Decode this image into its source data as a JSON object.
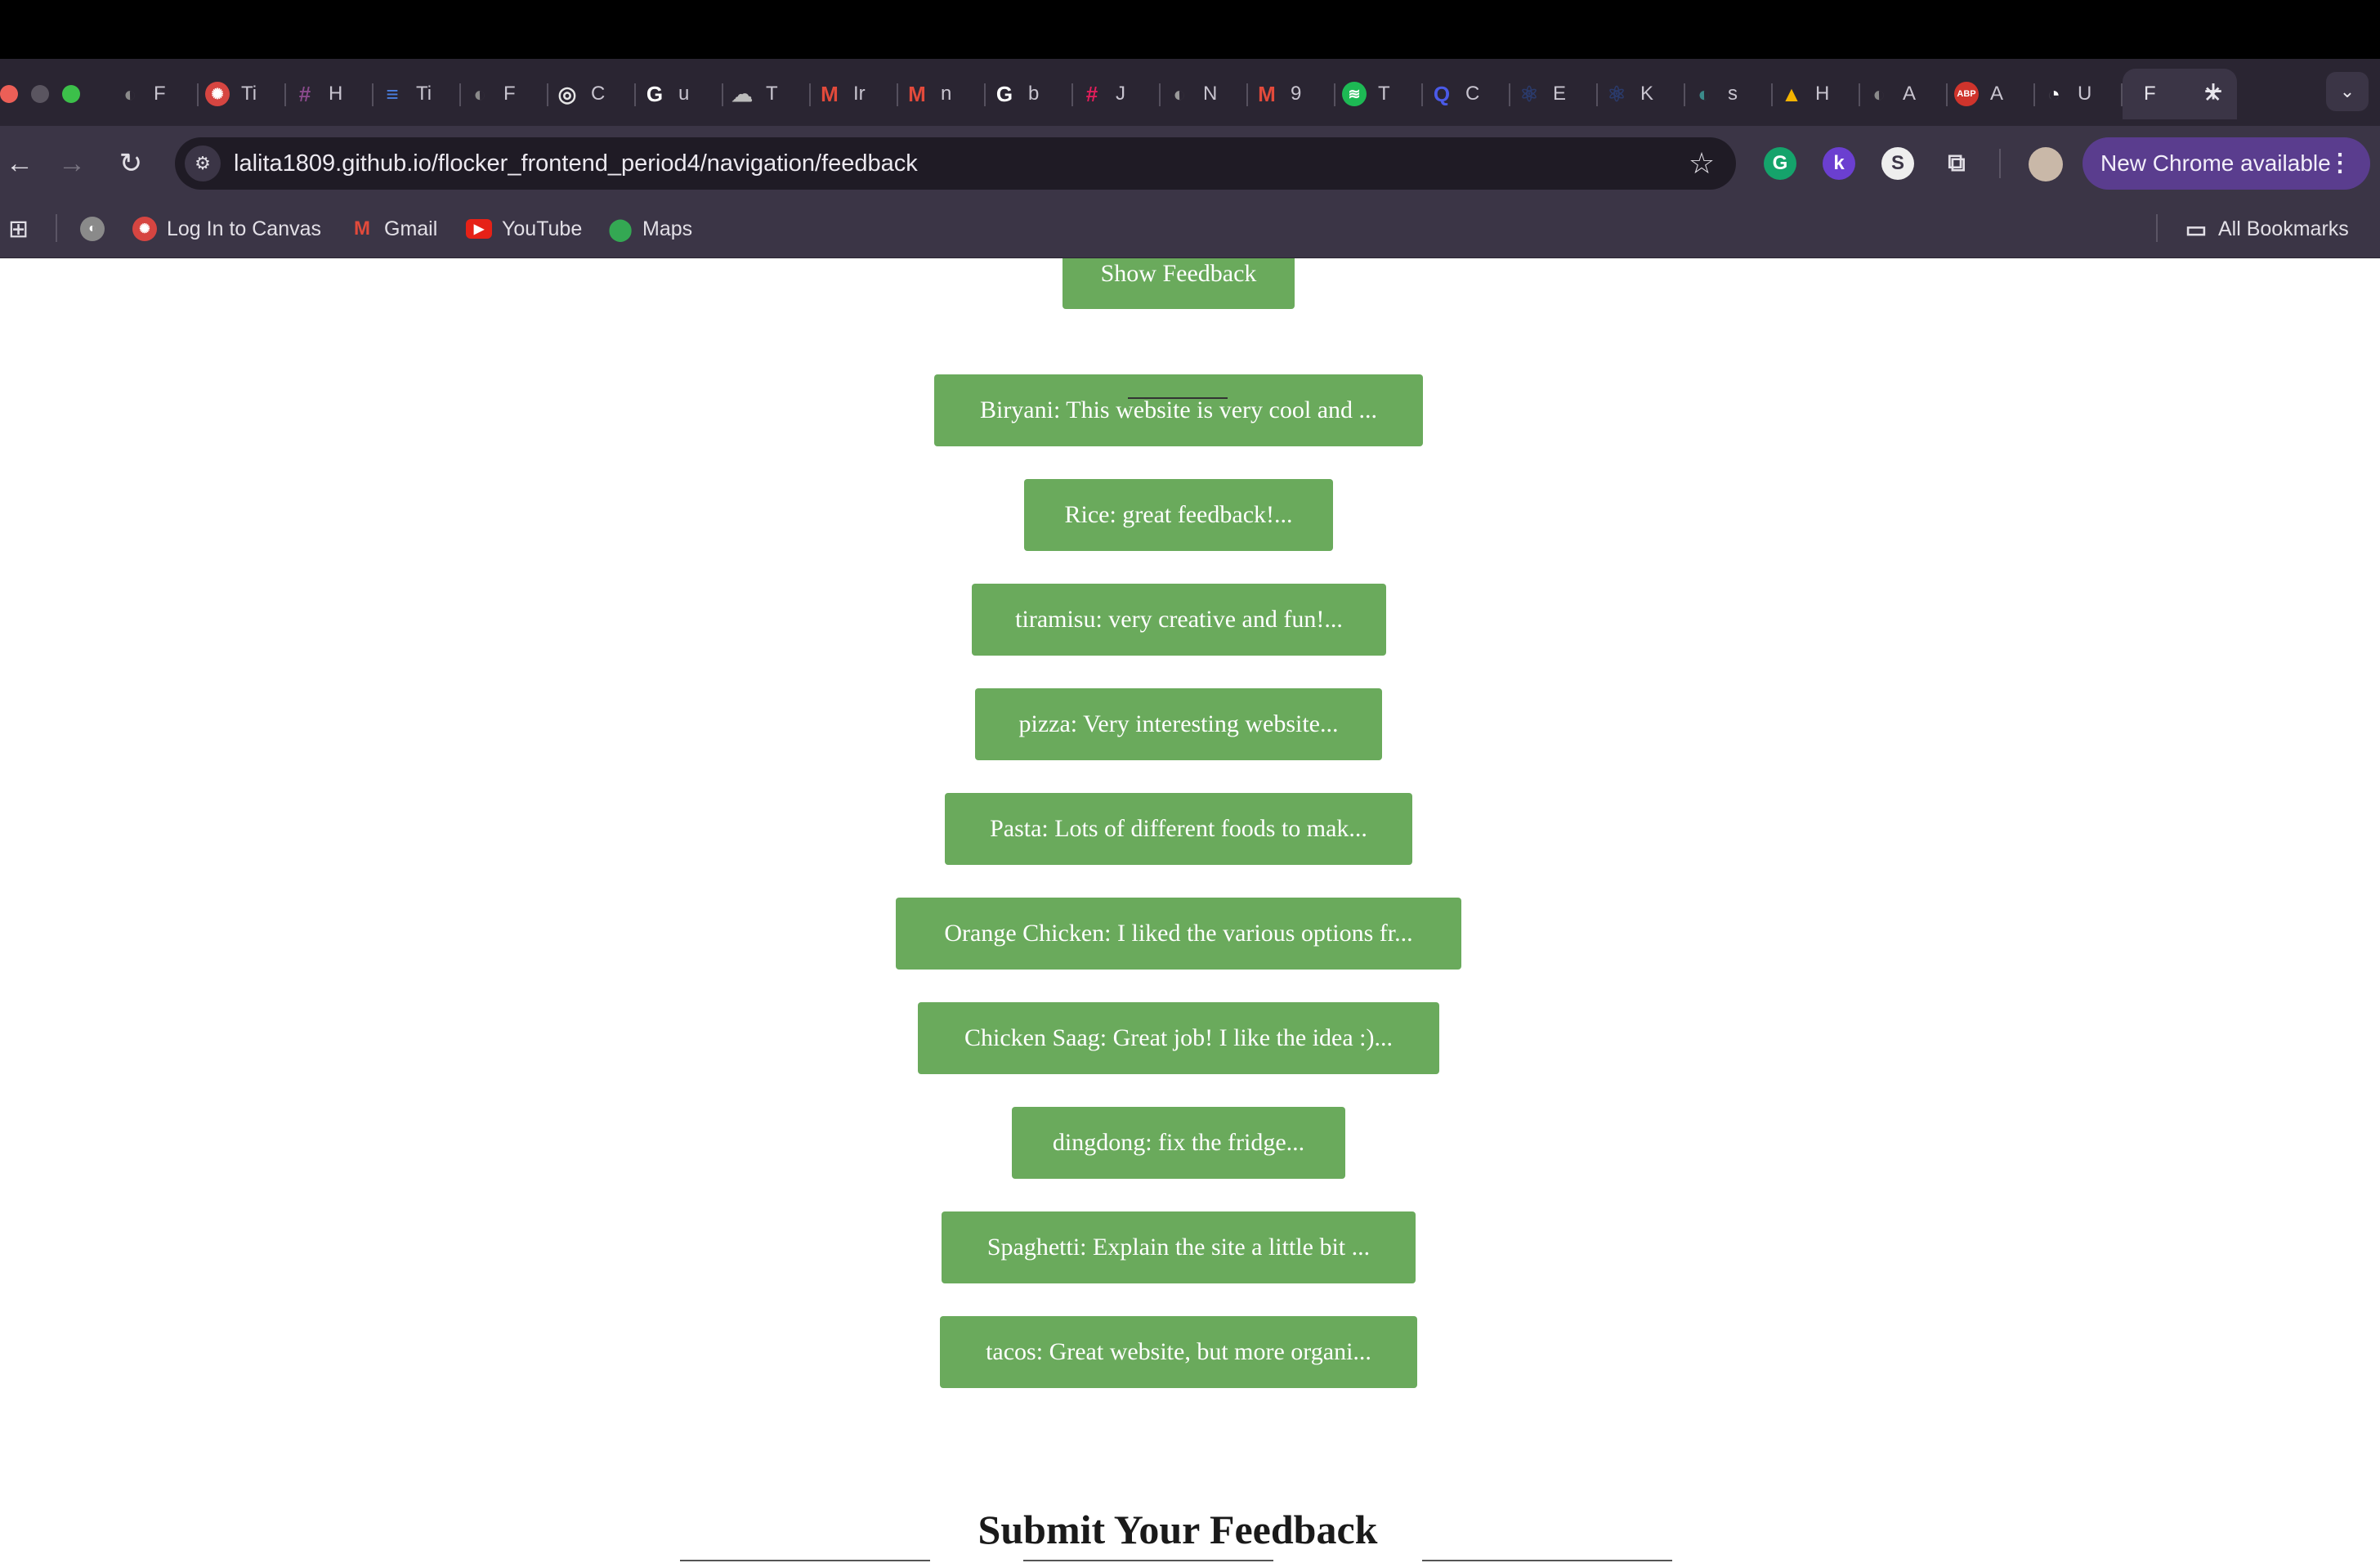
{
  "browser": {
    "tabs": [
      {
        "icon": "globe-icon",
        "label": "F",
        "color": "#8a8a8a"
      },
      {
        "icon": "canvas-icon",
        "label": "Ti",
        "color": "#d64541"
      },
      {
        "icon": "slack-icon",
        "label": "H",
        "color": "#8a4a8c"
      },
      {
        "icon": "docs-icon",
        "label": "Ti",
        "color": "#4a7fe0"
      },
      {
        "icon": "globe-icon",
        "label": "F",
        "color": "#8a8a8a"
      },
      {
        "icon": "openai-icon",
        "label": "C",
        "color": "#e6e6e6"
      },
      {
        "icon": "google-icon",
        "label": "u",
        "color": "#ffffff"
      },
      {
        "icon": "cloud-icon",
        "label": "T",
        "color": "#bbbbbb"
      },
      {
        "icon": "gmail-icon",
        "label": "Ir",
        "color": "#e24a3b"
      },
      {
        "icon": "gmail-icon",
        "label": "n",
        "color": "#e24a3b"
      },
      {
        "icon": "google-icon",
        "label": "b",
        "color": "#ffffff"
      },
      {
        "icon": "slack-icon",
        "label": "J",
        "color": "#e01e5a"
      },
      {
        "icon": "globe-icon",
        "label": "N",
        "color": "#9a9a9a"
      },
      {
        "icon": "gmail-icon",
        "label": "9",
        "color": "#e24a3b"
      },
      {
        "icon": "spotify-icon",
        "label": "T",
        "color": "#1db954"
      },
      {
        "icon": "search-circle-icon",
        "label": "C",
        "color": "#4a5ae8"
      },
      {
        "icon": "react-icon",
        "label": "E",
        "color": "#2a3a6a"
      },
      {
        "icon": "react-icon",
        "label": "K",
        "color": "#2a3a6a"
      },
      {
        "icon": "globe-icon",
        "label": "s",
        "color": "#3b8a8a"
      },
      {
        "icon": "drive-icon",
        "label": "H",
        "color": "#f4b400"
      },
      {
        "icon": "globe-icon",
        "label": "A",
        "color": "#8a8a8a"
      },
      {
        "icon": "adblock-icon",
        "label": "A",
        "color": "#d0342c"
      },
      {
        "icon": "github-icon",
        "label": "U",
        "color": "#ffffff"
      }
    ],
    "active_tab": {
      "label": "F"
    },
    "url": "lalita1809.github.io/flocker_frontend_period4/navigation/feedback",
    "update_button": "New Chrome available",
    "bookmarks": [
      {
        "label": "Log In to Canvas",
        "icon": "canvas-icon",
        "color": "#d64541"
      },
      {
        "label": "Gmail",
        "icon": "gmail-icon",
        "color": "#e24a3b"
      },
      {
        "label": "YouTube",
        "icon": "youtube-icon",
        "color": "#e62117"
      },
      {
        "label": "Maps",
        "icon": "maps-icon",
        "color": "#34a853"
      }
    ],
    "all_bookmarks": "All Bookmarks"
  },
  "page": {
    "show_button": "Show Feedback",
    "feedback": [
      "Biryani: This website is very cool and ...",
      "Rice: great feedback!...",
      "tiramisu: very creative and fun!...",
      "pizza: Very interesting website...",
      "Pasta: Lots of different foods to mak...",
      "Orange Chicken: I liked the various options fr...",
      "Chicken Saag: Great job! I like the idea :)...",
      "dingdong: fix the fridge...",
      "Spaghetti: Explain the site a little bit ...",
      "tacos: Great website, but more organi..."
    ],
    "submit_title": "Submit Your Feedback"
  },
  "colors": {
    "button_green": "#6aaa5c",
    "update_purple": "#5a3d8e"
  }
}
